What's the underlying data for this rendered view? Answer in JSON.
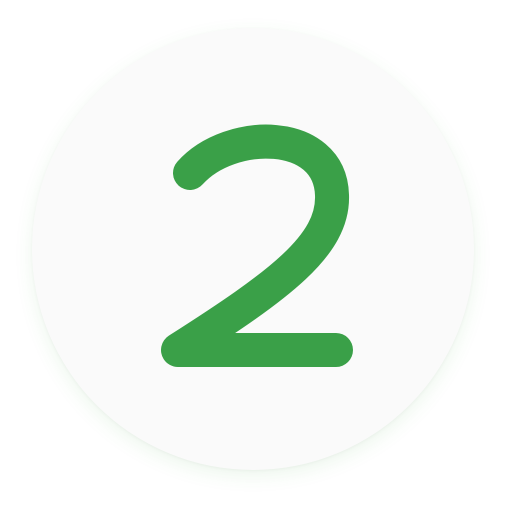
{
  "badge": {
    "digit": "2",
    "colors": {
      "circle": "#fafafa",
      "digit": "#3aa048",
      "shadow": "#4caf50"
    }
  }
}
